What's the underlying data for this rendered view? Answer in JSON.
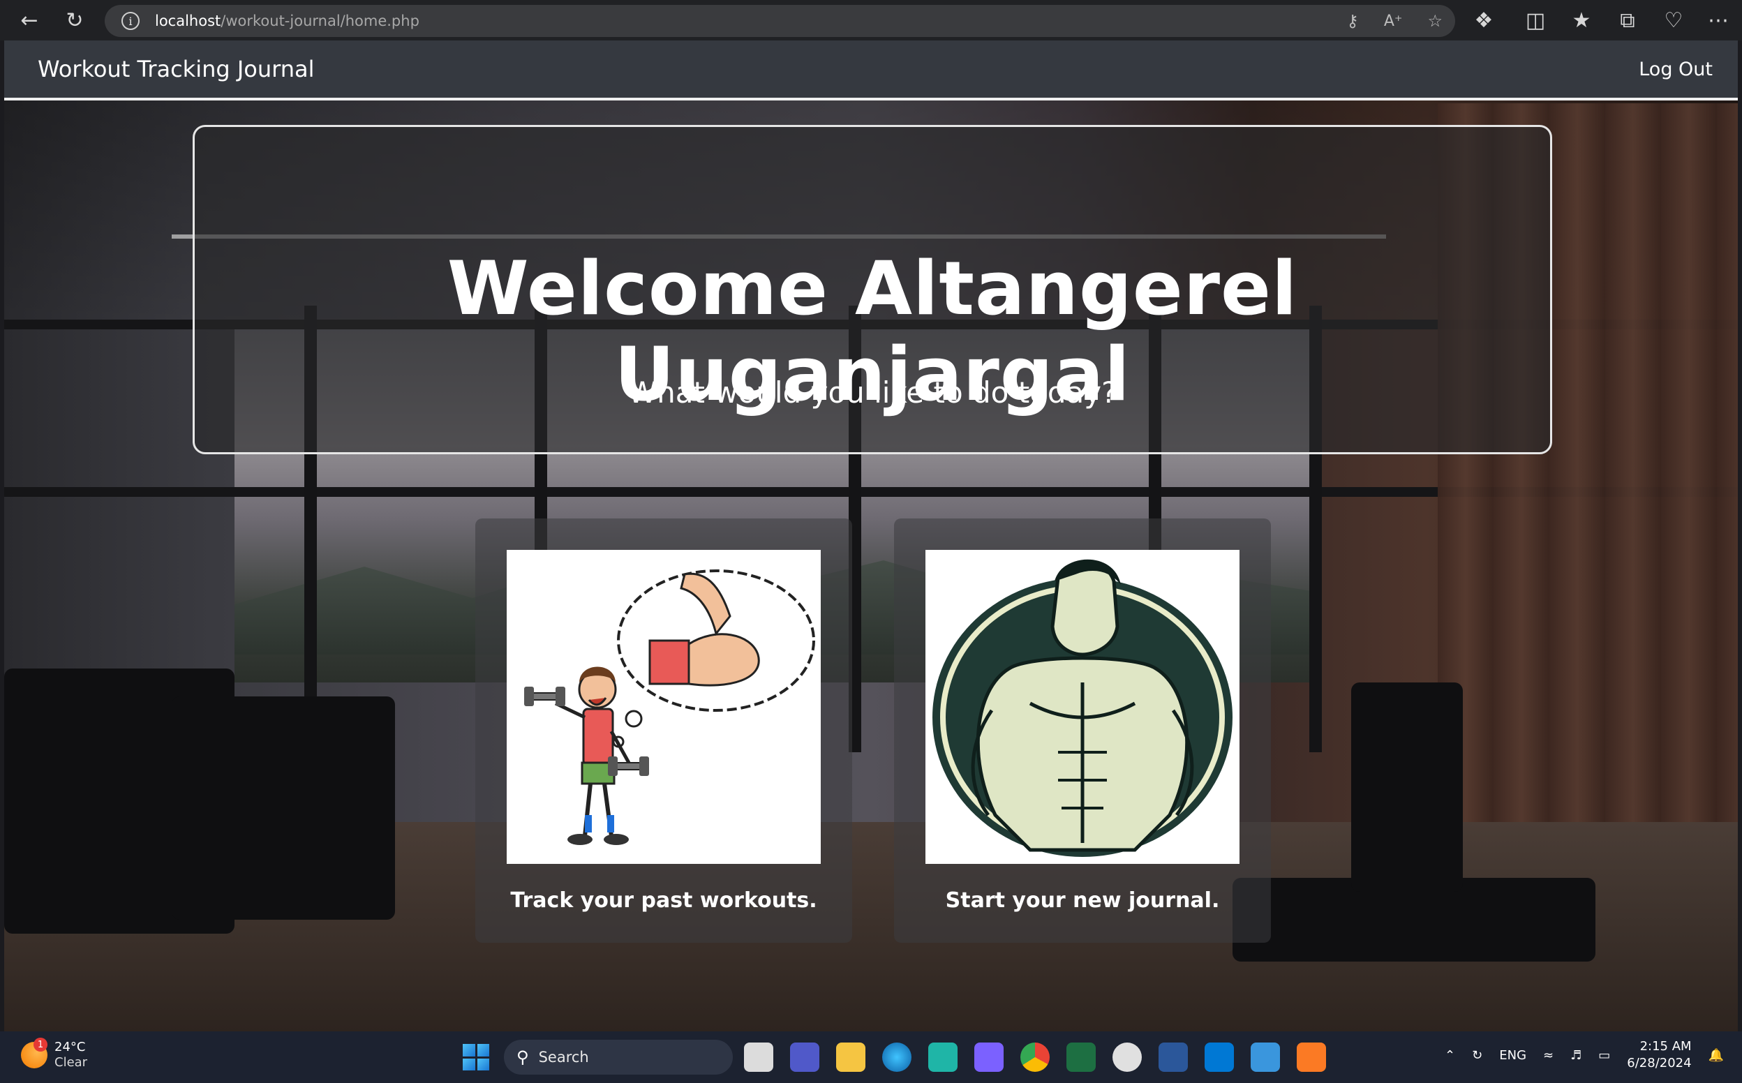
{
  "browser": {
    "url_host": "localhost",
    "url_path": "/workout-journal/home.php"
  },
  "navbar": {
    "brand": "Workout Tracking Journal",
    "logout_label": "Log Out"
  },
  "welcome": {
    "title": "Welcome Altangerel Uuganjargal",
    "subtitle": "What would you like to do today?"
  },
  "options": [
    {
      "label": "Track your past workouts.",
      "icon": "cartoon-dumbbell-icon"
    },
    {
      "label": "Start your new journal.",
      "icon": "muscle-man-icon"
    }
  ],
  "taskbar": {
    "weather_temp": "24°C",
    "weather_condition": "Clear",
    "weather_badge": "1",
    "search_placeholder": "Search",
    "language": "ENG",
    "time": "2:15 AM",
    "date": "6/28/2024"
  },
  "colors": {
    "navbar_bg": "#353940",
    "taskbar_bg": "#1c2230",
    "text": "#ffffff"
  }
}
